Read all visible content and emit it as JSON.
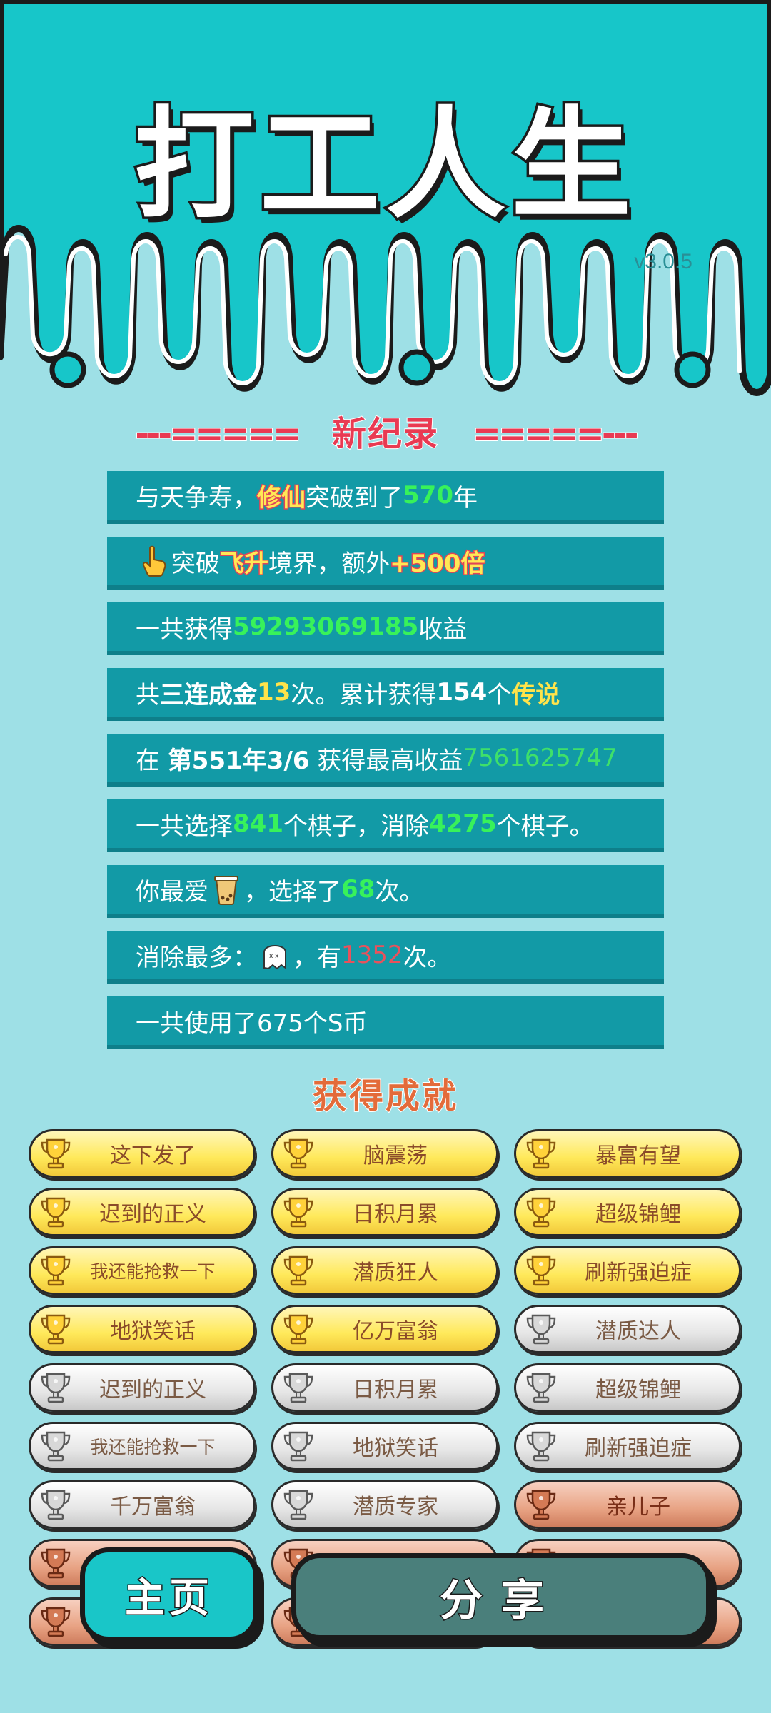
{
  "header": {
    "title": "打工人生",
    "version": "v3.0.5"
  },
  "new_record": {
    "label": "新纪录",
    "dashes_left": "---=====",
    "dashes_right": "=====---"
  },
  "stats": {
    "r1": {
      "a": "与天争寿，",
      "b": "修仙",
      "c": "突破到了",
      "d": "570",
      "e": "年"
    },
    "r2": {
      "a": "突破",
      "b": "飞升",
      "c": "境界，额外",
      "d": "+500倍"
    },
    "r3": {
      "a": "一共获得",
      "b": "59293069185",
      "c": "收益"
    },
    "r4": {
      "a": "共",
      "b": "三连成金",
      "c": "13",
      "d": "次。累计获得",
      "e": "154",
      "f": "个",
      "g": "传说"
    },
    "r5": {
      "a": "在 ",
      "b": "第551年3/6",
      "c": " 获得最高收益",
      "d": "7561625747"
    },
    "r6": {
      "a": "一共选择",
      "b": "841",
      "c": "个棋子，消除",
      "d": "4275",
      "e": "个棋子。"
    },
    "r7": {
      "a": "你最爱",
      "b": "，选择了",
      "c": "68",
      "d": "次。"
    },
    "r8": {
      "a": "消除最多：",
      "b": "，有",
      "c": "1352",
      "d": "次。"
    },
    "r9": {
      "a": "一共使用了675个S币"
    }
  },
  "achievements": {
    "title": "获得成就",
    "items": [
      {
        "label": "这下发了",
        "tier": "gold"
      },
      {
        "label": "脑震荡",
        "tier": "gold"
      },
      {
        "label": "暴富有望",
        "tier": "gold"
      },
      {
        "label": "迟到的正义",
        "tier": "gold"
      },
      {
        "label": "日积月累",
        "tier": "gold"
      },
      {
        "label": "超级锦鲤",
        "tier": "gold"
      },
      {
        "label": "我还能抢救一下",
        "tier": "gold"
      },
      {
        "label": "潜质狂人",
        "tier": "gold"
      },
      {
        "label": "刷新强迫症",
        "tier": "gold"
      },
      {
        "label": "地狱笑话",
        "tier": "gold"
      },
      {
        "label": "亿万富翁",
        "tier": "gold"
      },
      {
        "label": "潜质达人",
        "tier": "silver"
      },
      {
        "label": "迟到的正义",
        "tier": "silver"
      },
      {
        "label": "日积月累",
        "tier": "silver"
      },
      {
        "label": "超级锦鲤",
        "tier": "silver"
      },
      {
        "label": "我还能抢救一下",
        "tier": "silver"
      },
      {
        "label": "地狱笑话",
        "tier": "silver"
      },
      {
        "label": "刷新强迫症",
        "tier": "silver"
      },
      {
        "label": "千万富翁",
        "tier": "silver"
      },
      {
        "label": "潜质专家",
        "tier": "silver"
      },
      {
        "label": "亲儿子",
        "tier": "bronze"
      },
      {
        "label": "",
        "tier": "bronze"
      },
      {
        "label": "",
        "tier": "bronze"
      },
      {
        "label": "",
        "tier": "bronze"
      },
      {
        "label": "",
        "tier": "bronze"
      },
      {
        "label": "",
        "tier": "bronze"
      },
      {
        "label": "",
        "tier": "bronze"
      }
    ]
  },
  "buttons": {
    "home": "主页",
    "share": "分享"
  },
  "icons": {
    "stat_2": "pointing-hand-icon",
    "stat_7": "bubble-tea-icon",
    "stat_8": "ghost-icon",
    "badge": "trophy-icon"
  },
  "colors": {
    "sky": "#17c6c9",
    "background": "#9ee0e6",
    "stat_row": "#129aa6",
    "accent_red": "#e93a52",
    "accent_green": "#38f25a",
    "accent_yellow": "#ffe34a"
  }
}
